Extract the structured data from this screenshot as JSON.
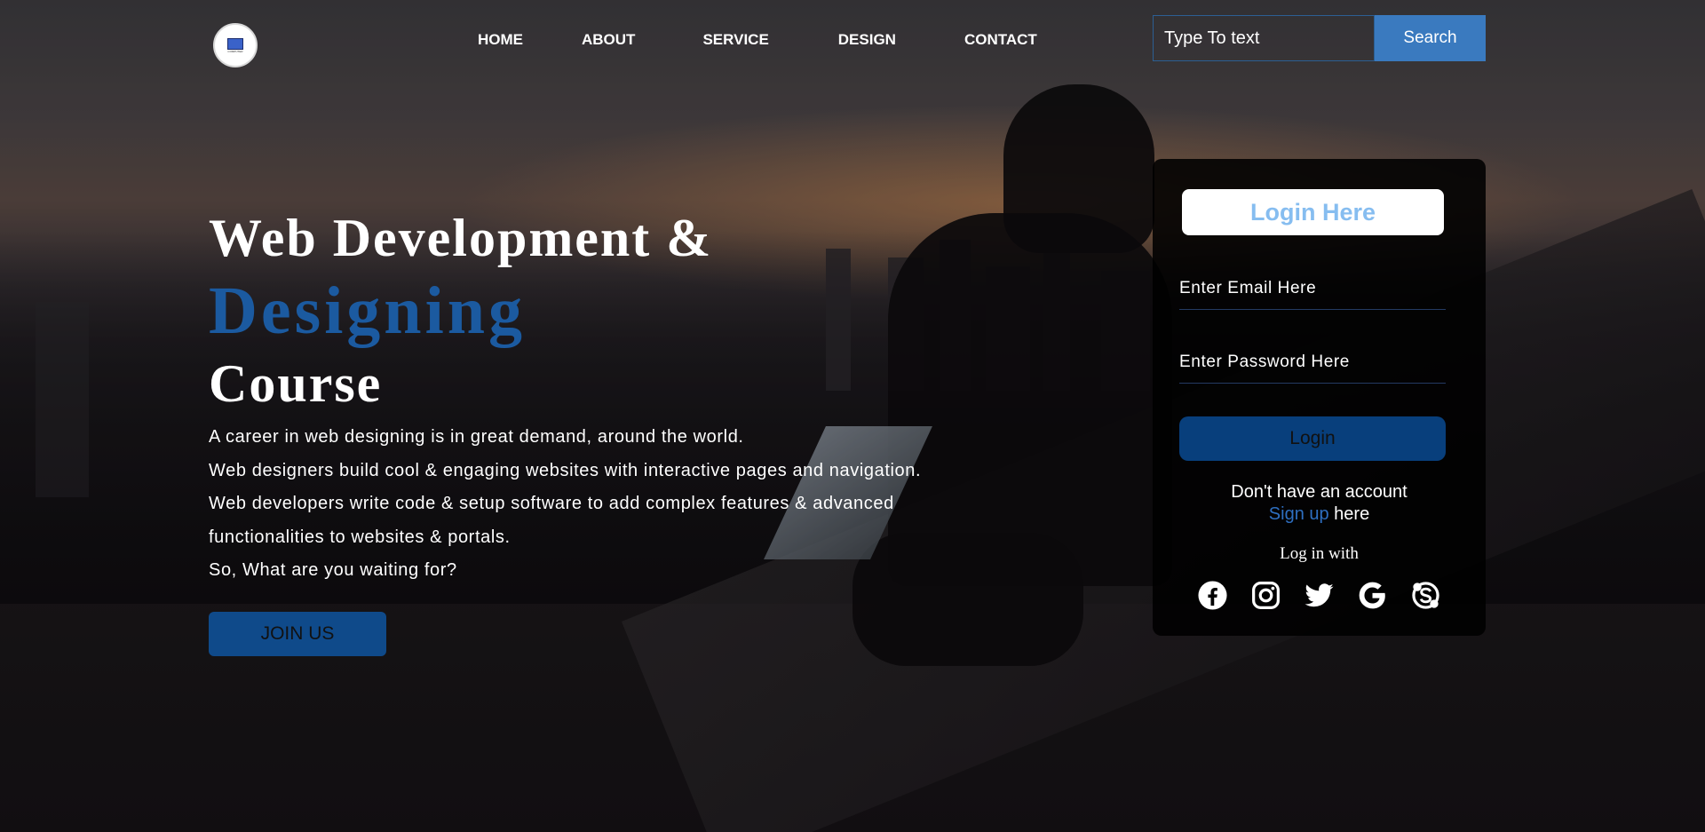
{
  "header": {
    "logo_text": "COMPUTER",
    "nav": [
      "HOME",
      "ABOUT",
      "SERVICE",
      "DESIGN",
      "CONTACT"
    ],
    "search": {
      "placeholder": "Type To text",
      "button_label": "Search"
    }
  },
  "hero": {
    "title_line1": "Web Development &",
    "title_line2": "Designing",
    "title_line3": "Course",
    "description": [
      "A career in web designing is in great demand, around the world.",
      "Web designers build cool & engaging websites with interactive pages and navigation.",
      "Web developers write code & setup software to add complex features & advanced",
      "functionalities to websites & portals.",
      "So, What are you waiting for?"
    ],
    "cta_label": "JOIN US"
  },
  "login": {
    "title": "Login Here",
    "email_placeholder": "Enter Email Here",
    "password_placeholder": "Enter Password Here",
    "button_label": "Login",
    "no_account_text": "Don't have an account",
    "signup_link": "Sign up",
    "signup_suffix": " here",
    "login_with": "Log in with",
    "social_icons": [
      "facebook-icon",
      "instagram-icon",
      "twitter-icon",
      "google-icon",
      "skype-icon"
    ]
  },
  "colors": {
    "accent": "#1b5aa0",
    "search_button": "#3a7abf",
    "login_title": "#86bdf0",
    "button_bg": "#083f7c"
  }
}
